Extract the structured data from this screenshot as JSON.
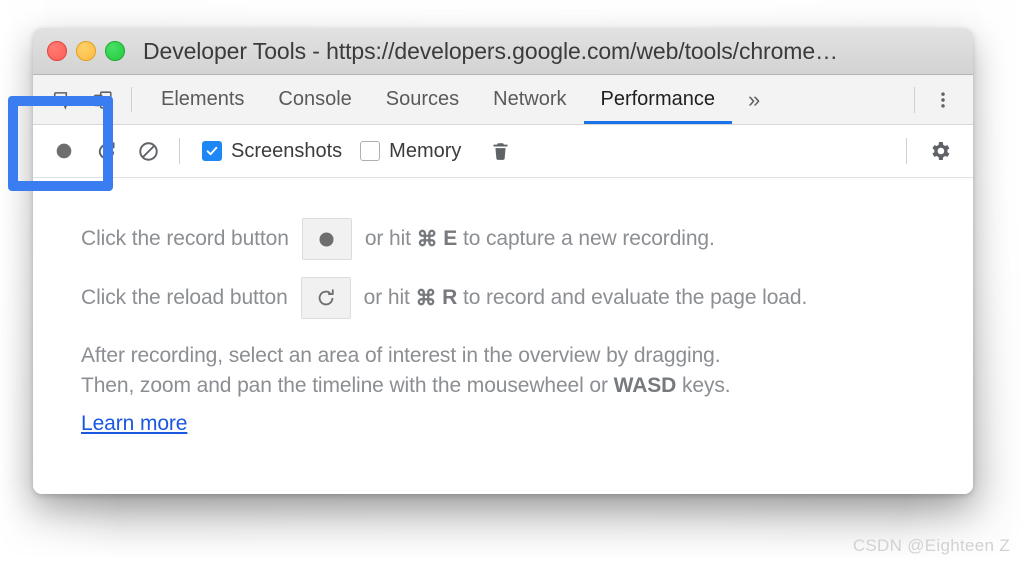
{
  "window": {
    "title": "Developer Tools - https://developers.google.com/web/tools/chrome…",
    "traffic_lights": {
      "close": "close-window",
      "minimize": "minimize-window",
      "maximize": "maximize-window"
    }
  },
  "tab_bar": {
    "left_icons": [
      {
        "name": "inspect-element-icon",
        "label": "Inspect element"
      },
      {
        "name": "device-toolbar-icon",
        "label": "Toggle device toolbar"
      }
    ],
    "tabs": [
      {
        "label": "Elements",
        "active": false
      },
      {
        "label": "Console",
        "active": false
      },
      {
        "label": "Sources",
        "active": false
      },
      {
        "label": "Network",
        "active": false
      },
      {
        "label": "Performance",
        "active": true
      }
    ],
    "more_tabs_label": "»",
    "menu_label": "Customize and control DevTools",
    "active_tab_accent": "#1a73e8"
  },
  "toolbar": {
    "record_button_label": "Record",
    "reload_button_label": "Start profiling and reload page",
    "clear_button_label": "Clear",
    "screenshots": {
      "label": "Screenshots",
      "checked": true
    },
    "memory": {
      "label": "Memory",
      "checked": false
    },
    "trash_label": "Collect garbage",
    "settings_label": "Capture settings",
    "checked_color": "#1f87f5"
  },
  "panel": {
    "line1": {
      "before": "Click the record button",
      "after_pre": "or hit ",
      "cmd": "⌘",
      "key": "E",
      "after_post": " to capture a new recording.",
      "button_icon": "record-dot-icon"
    },
    "line2": {
      "before": "Click the reload button",
      "after_pre": "or hit ",
      "cmd": "⌘",
      "key": "R",
      "after_post": " to record and evaluate the page load.",
      "button_icon": "reload-icon"
    },
    "paragraph_line1": "After recording, select an area of interest in the overview by dragging.",
    "paragraph_line2_a": "Then, zoom and pan the timeline with the mousewheel or ",
    "paragraph_line2_keys": "WASD",
    "paragraph_line2_b": " keys.",
    "learn_more": "Learn more",
    "link_color": "#1a58e0"
  },
  "annotation": {
    "highlight_target": "record-button",
    "color": "#3a7df0"
  },
  "watermark": "CSDN @Eighteen Z"
}
